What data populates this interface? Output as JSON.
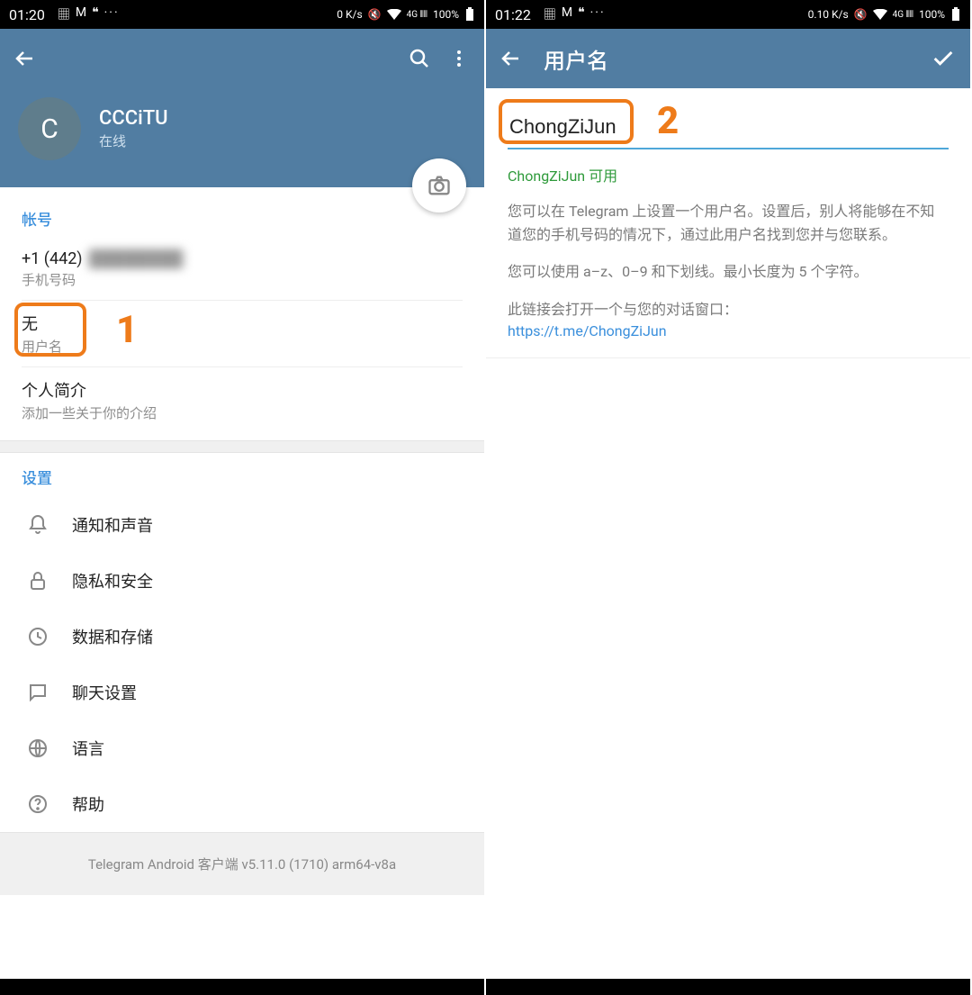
{
  "left": {
    "status": {
      "time": "01:20",
      "net": "0 K/s",
      "battery": "100%"
    },
    "profile": {
      "avatar_letter": "C",
      "name": "CCCiTU",
      "status": "在线"
    },
    "account": {
      "header": "帐号",
      "phone_prefix": "+1 (442) ",
      "phone_hidden": "████████",
      "phone_label": "手机号码",
      "username_value": "无",
      "username_label": "用户名",
      "bio_value": "个人简介",
      "bio_label": "添加一些关于你的介绍"
    },
    "settings": {
      "header": "设置",
      "items": [
        {
          "icon": "bell",
          "label": "通知和声音"
        },
        {
          "icon": "lock",
          "label": "隐私和安全"
        },
        {
          "icon": "clock",
          "label": "数据和存储"
        },
        {
          "icon": "chat",
          "label": "聊天设置"
        },
        {
          "icon": "globe",
          "label": "语言"
        },
        {
          "icon": "help",
          "label": "帮助"
        }
      ]
    },
    "footer": "Telegram Android 客户端 v5.11.0 (1710) arm64-v8a",
    "annotation": "1"
  },
  "right": {
    "status": {
      "time": "01:22",
      "net": "0.10 K/s",
      "battery": "100%"
    },
    "appbar_title": "用户名",
    "username_value": "ChongZiJun",
    "check_text": "ChongZiJun 可用",
    "desc1": "您可以在 Telegram 上设置一个用户名。设置后，别人将能够在不知道您的手机号码的情况下，通过此用户名找到您并与您联系。",
    "desc2": "您可以使用 a–z、0–9 和下划线。最小长度为 5 个字符。",
    "desc3": "此链接会打开一个与您的对话窗口：",
    "link": "https://t.me/ChongZiJun",
    "annotation": "2"
  }
}
